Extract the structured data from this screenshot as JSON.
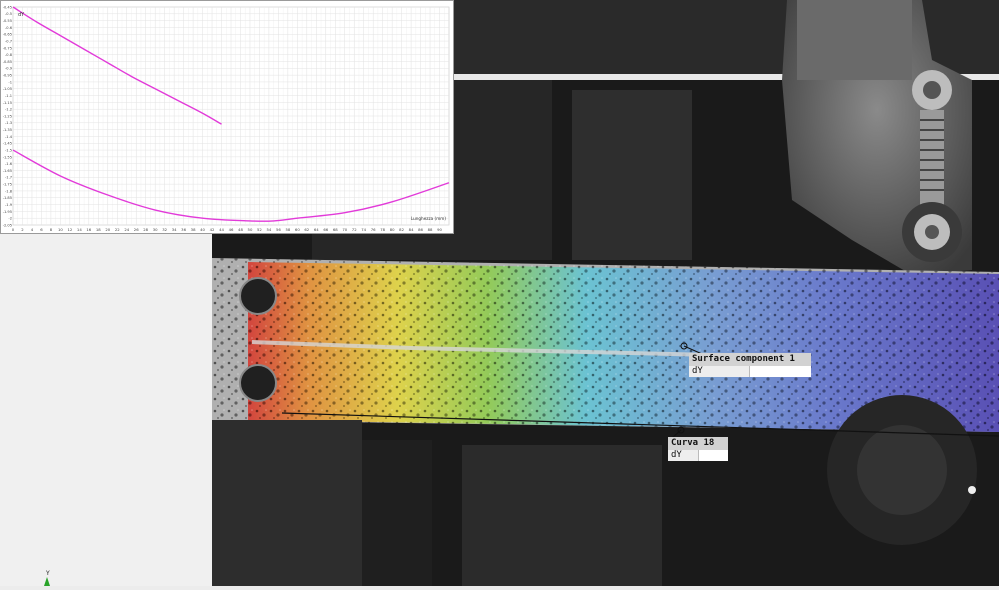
{
  "chart": {
    "x_axis_label": "Lunghezza (mm)",
    "y_axis_label": "dY",
    "line_color": "#e23ad9"
  },
  "chart_data": {
    "type": "line",
    "xlabel": "Lunghezza (mm)",
    "ylabel": "dY",
    "xlim": [
      0,
      92
    ],
    "ylim": [
      -2.05,
      -0.45
    ],
    "x_ticks": [
      0,
      2,
      4,
      6,
      8,
      10,
      12,
      14,
      16,
      18,
      20,
      22,
      24,
      26,
      28,
      30,
      32,
      34,
      36,
      38,
      40,
      42,
      44,
      46,
      48,
      50,
      52,
      54,
      56,
      58,
      60,
      62,
      64,
      66,
      68,
      70,
      72,
      74,
      76,
      78,
      80,
      82,
      84,
      86,
      88,
      90
    ],
    "y_ticks": [
      "-0.45",
      "-0.5",
      "-0.55",
      "-0.6",
      "-0.65",
      "-0.7",
      "-0.75",
      "-0.8",
      "-0.85",
      "-0.9",
      "-0.95",
      "-1",
      "-1.05",
      "-1.1",
      "-1.15",
      "-1.2",
      "-1.25",
      "-1.3",
      "-1.35",
      "-1.4",
      "-1.45",
      "-1.5",
      "-1.55",
      "-1.6",
      "-1.65",
      "-1.7",
      "-1.75",
      "-1.8",
      "-1.85",
      "-1.9",
      "-1.95",
      "-2",
      "-2.05"
    ],
    "series": [
      {
        "x": [
          0,
          5,
          10,
          15,
          20,
          25,
          30,
          35,
          40,
          44
        ],
        "y": [
          -0.45,
          -0.56,
          -0.66,
          -0.76,
          -0.86,
          -0.96,
          -1.05,
          -1.14,
          -1.23,
          -1.31
        ]
      },
      {
        "x": [
          0,
          10,
          20,
          30,
          40,
          50,
          55,
          60,
          70,
          80,
          92
        ],
        "y": [
          -1.5,
          -1.69,
          -1.83,
          -1.94,
          -2.0,
          -2.02,
          -2.02,
          -2.0,
          -1.96,
          -1.88,
          -1.74
        ]
      }
    ]
  },
  "overlays": {
    "surface_component": {
      "title": "Surface component 1",
      "row_label": "dY"
    },
    "curve": {
      "title": "Curva 18",
      "row_label": "dY"
    }
  },
  "axis_triad": {
    "y_label": "Y"
  },
  "colors": {
    "strain_red": "#d8322a",
    "strain_orange": "#e88d2e",
    "strain_yellow": "#e6d83a",
    "strain_green": "#8ecf4a",
    "strain_cyan": "#5fc6d8",
    "strain_blue": "#5d6fd0",
    "strain_navy": "#4a3fb5"
  }
}
